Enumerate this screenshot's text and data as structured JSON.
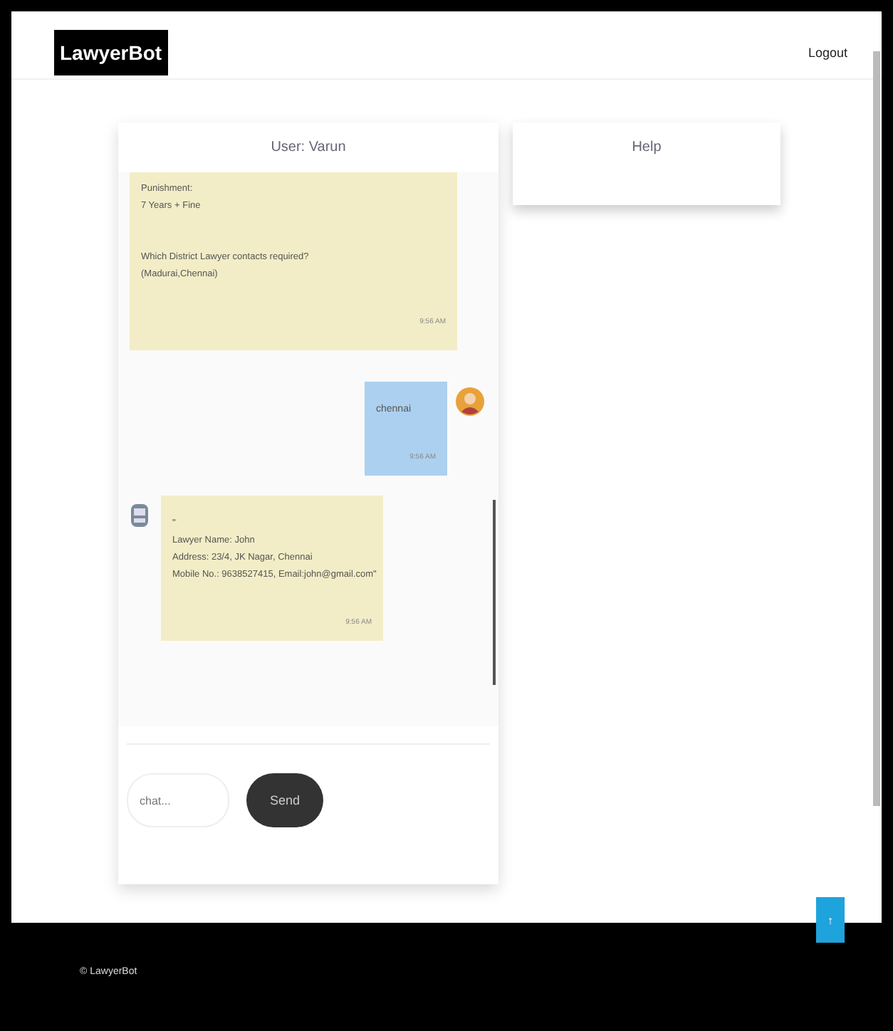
{
  "header": {
    "logo": "LawyerBot",
    "logout": "Logout"
  },
  "chat": {
    "title": "User: Varun",
    "messages": [
      {
        "kind": "bot",
        "avatar": false,
        "paragraphs": [
          [
            "Punishment:",
            "7 Years + Fine"
          ],
          [
            "Which District Lawyer contacts required?",
            "(Madurai,Chennai)"
          ]
        ],
        "time": "9:56 AM"
      },
      {
        "kind": "user",
        "paragraphs": [
          [
            "chennai"
          ]
        ],
        "time": "9:56 AM"
      },
      {
        "kind": "bot",
        "avatar": true,
        "paragraphs": [
          [
            "\"",
            "Lawyer Name: John",
            "Address: 23/4, JK Nagar, Chennai",
            "Mobile No.: 9638527415, Email:john@gmail.com\""
          ]
        ],
        "time": "9:56 AM"
      }
    ],
    "input": {
      "placeholder": "chat..."
    },
    "send": "Send"
  },
  "help": {
    "title": "Help"
  },
  "footer": {
    "text": "© LawyerBot",
    "top_button": "↑"
  }
}
